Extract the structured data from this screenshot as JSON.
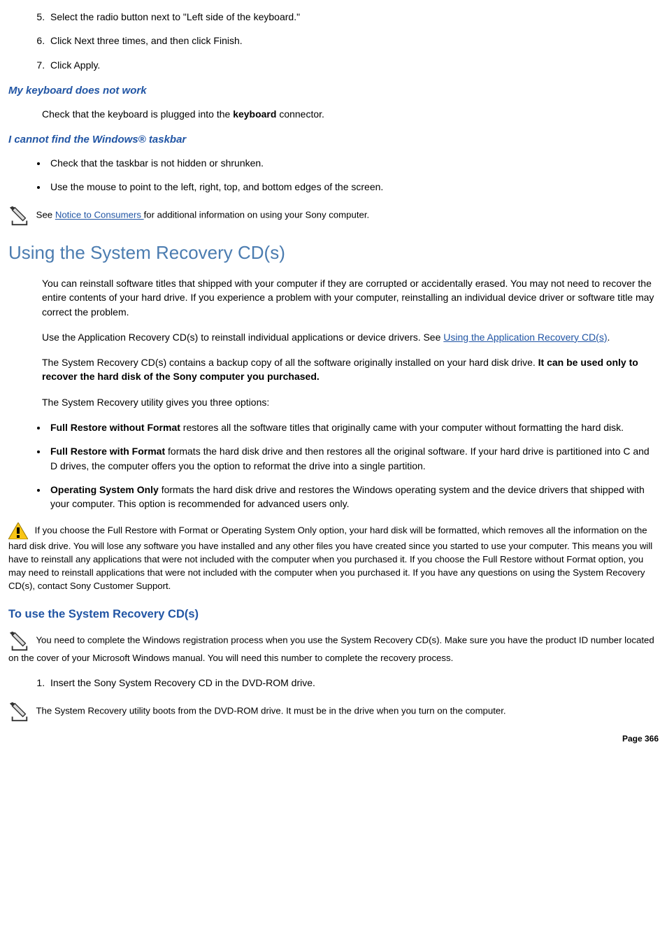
{
  "steps_first": [
    "Select the radio button next to \"Left side of the keyboard.\"",
    "Click Next three times, and then click Finish.",
    "Click Apply."
  ],
  "kb": {
    "heading": "My keyboard does not work",
    "text_pre": "Check that the keyboard is plugged into the ",
    "bold": "keyboard",
    "text_post": " connector."
  },
  "taskbar": {
    "heading": "I cannot find the Windows® taskbar",
    "items": [
      "Check that the taskbar is not hidden or shrunken.",
      "Use the mouse to point to the left, right, top, and bottom edges of the screen."
    ]
  },
  "notice": {
    "pre": "See ",
    "link": "Notice to Consumers ",
    "post": "for additional information on using your Sony computer."
  },
  "sysrec": {
    "title": "Using the System Recovery CD(s)",
    "p1": "You can reinstall software titles that shipped with your computer if they are corrupted or accidentally erased. You may not need to recover the entire contents of your hard drive. If you experience a problem with your computer, reinstalling an individual device driver or software title may correct the problem.",
    "p2_pre": "Use the Application Recovery CD(s) to reinstall individual applications or device drivers. See ",
    "p2_link": "Using the Application Recovery CD(s)",
    "p2_post": ".",
    "p3_pre": "The System Recovery CD(s) contains a backup copy of all the software originally installed on your hard disk drive. ",
    "p3_bold": "It can be used only to recover the hard disk of the Sony computer you purchased.",
    "p4": "The System Recovery utility gives you three options:",
    "opts": [
      {
        "b": "Full Restore without Format",
        "t": " restores all the software titles that originally came with your computer without formatting the hard disk."
      },
      {
        "b": "Full Restore with Format",
        "t": " formats the hard disk drive and then restores all the original software. If your hard drive is partitioned into C and D drives, the computer offers you the option to reformat the drive into a single partition."
      },
      {
        "b": "Operating System Only",
        "t": " formats the hard disk drive and restores the Windows operating system and the device drivers that shipped with your computer. This option is recommended for advanced users only."
      }
    ],
    "caution": "If you choose the Full Restore with Format or Operating System Only option, your hard disk will be formatted, which removes all the information on the hard disk drive. You will lose any software you have installed and any other files you have created since you started to use your computer. This means you will have to reinstall any applications that were not included with the computer when you purchased it. If you choose the Full Restore without Format option, you may need to reinstall applications that were not included with the computer when you purchased it. If you have any questions on using the System Recovery CD(s), contact Sony Customer Support."
  },
  "touse": {
    "heading": "To use the System Recovery CD(s)",
    "note1": "You need to complete the Windows registration process when you use the System Recovery CD(s). Make sure you have the product ID number located on the cover of your Microsoft Windows manual. You will need this number to complete the recovery process.",
    "step1": "Insert the Sony System Recovery CD in the DVD-ROM drive.",
    "note2": "The System Recovery utility boots from the DVD-ROM drive. It must be in the drive when you turn on the computer."
  },
  "page": "Page 366"
}
